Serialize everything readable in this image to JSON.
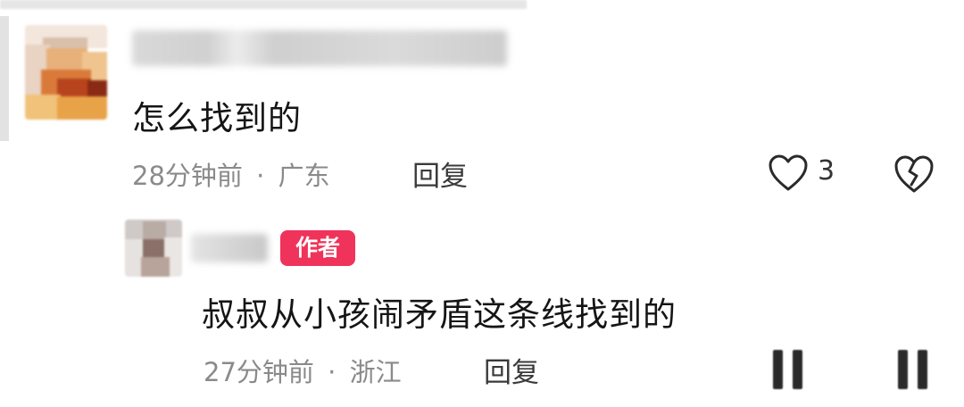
{
  "comments": [
    {
      "text": "怎么找到的",
      "time": "28分钟前",
      "separator": "·",
      "location": "广东",
      "reply_label": "回复",
      "like_count": "3",
      "like_icon": "heart-outline-icon",
      "dislike_icon": "broken-heart-icon"
    },
    {
      "author_badge": "作者",
      "text": "叔叔从小孩闹矛盾这条线找到的",
      "time": "27分钟前",
      "separator": "·",
      "location": "浙江",
      "reply_label": "回复"
    }
  ],
  "colors": {
    "badge_bg": "#f0335a",
    "meta_text": "#8a8a8a",
    "body_text": "#151515"
  }
}
